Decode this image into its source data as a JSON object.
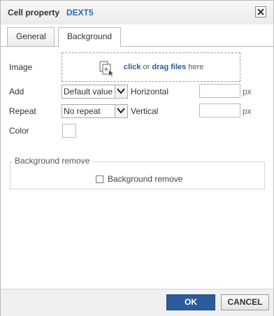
{
  "dialog": {
    "title": "Cell property",
    "doc_name": "DEXT5"
  },
  "tabs": [
    {
      "label": "General"
    },
    {
      "label": "Background"
    }
  ],
  "image": {
    "label": "Image",
    "drop_click": "click",
    "drop_or": " or ",
    "drop_drag": "drag files",
    "drop_here": " here"
  },
  "add": {
    "label": "Add",
    "value": "Default value"
  },
  "repeat": {
    "label": "Repeat",
    "value": "No repeat"
  },
  "horizontal": {
    "label": "Horizontal",
    "unit": "px"
  },
  "vertical": {
    "label": "Vertical",
    "unit": "px"
  },
  "color": {
    "label": "Color"
  },
  "bg_remove": {
    "legend": "Background remove",
    "checkbox_label": "Background remove"
  },
  "buttons": {
    "ok": "OK",
    "cancel": "CANCEL"
  }
}
